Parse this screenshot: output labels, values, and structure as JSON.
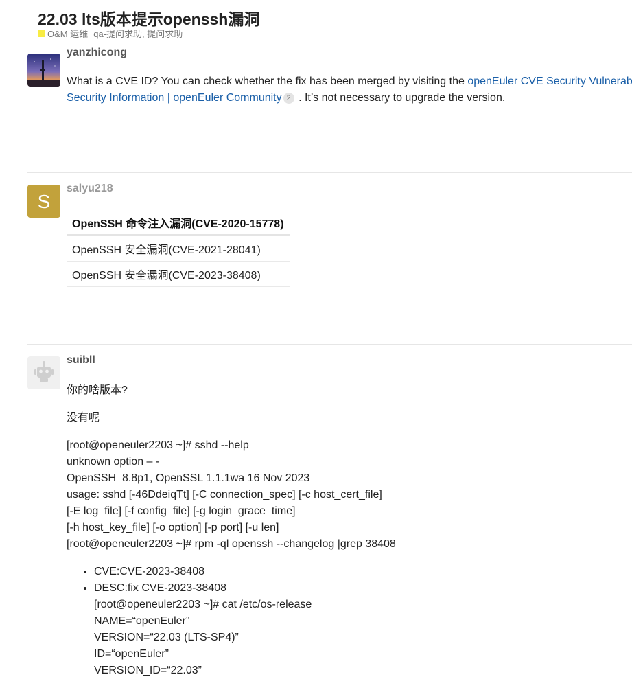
{
  "topic": {
    "title": "22.03 lts版本提示openssh漏洞",
    "category": "O&M 运维",
    "tags": "qa-提问求助, 提问求助",
    "category_color": "#f8ec44"
  },
  "posts": [
    {
      "username": "yanzhicong",
      "line1_text": "What is a CVE ID? You can check whether the fix has been merged by visiting the ",
      "line1_link": "openEuler CVE Security Vulnerab",
      "line2_link": "Security Information | openEuler Community",
      "link_count": "2",
      "line2_suffix": " . It’s not necessary to upgrade the version."
    },
    {
      "username": "salyu218",
      "avatar_letter": "S",
      "avatar_color": "#c2a23b",
      "table_header": "OpenSSH 命令注入漏洞(CVE-2020-15778)",
      "table_rows": [
        "OpenSSH 安全漏洞(CVE-2021-28041)",
        "OpenSSH 安全漏洞(CVE-2023-38408)"
      ]
    },
    {
      "username": "suibll",
      "p1": "你的啥版本?",
      "p2": "没有呢",
      "code_lines": [
        "[root@openeuler2203 ~]# sshd --help",
        "unknown option – -",
        "OpenSSH_8.8p1, OpenSSL 1.1.1wa 16 Nov 2023",
        "usage: sshd [-46DdeiqTt] [-C connection_spec] [-c host_cert_file]",
        "[-E log_file] [-f config_file] [-g login_grace_time]",
        "[-h host_key_file] [-o option] [-p port] [-u len]",
        "[root@openeuler2203 ~]# rpm -ql openssh --changelog |grep 38408"
      ],
      "bullet1": "CVE:CVE-2023-38408",
      "bullet2_lines": [
        "DESC:fix CVE-2023-38408",
        "[root@openeuler2203 ~]# cat /etc/os-release",
        "NAME=“openEuler”",
        "VERSION=“22.03 (LTS-SP4)”",
        "ID=“openEuler”",
        "VERSION_ID=“22.03”"
      ]
    }
  ]
}
